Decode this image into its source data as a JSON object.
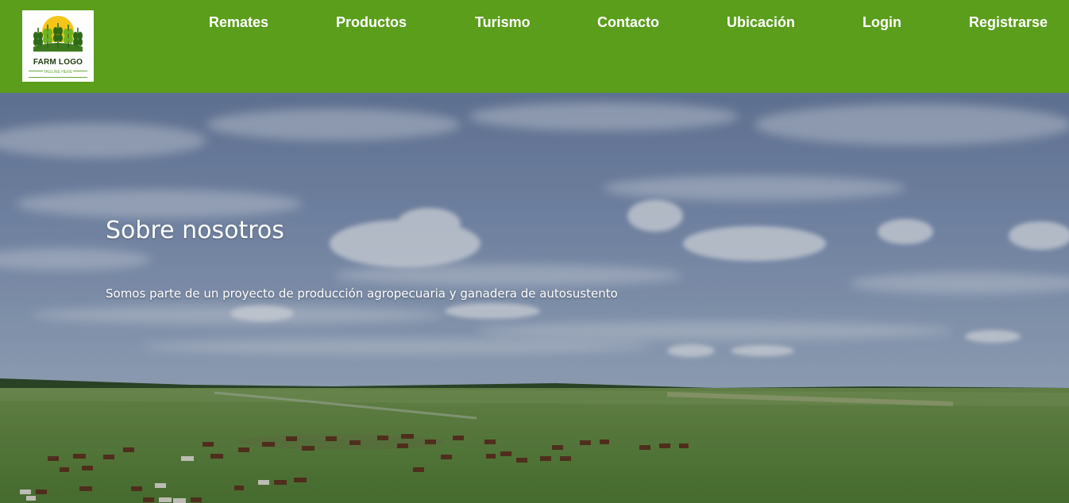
{
  "header": {
    "bg_color": "#5a9e1b",
    "logo": {
      "title": "FARM LOGO",
      "tagline": "TAGLINE HERE",
      "icon": "farm-sun-wheat-icon"
    },
    "nav": [
      {
        "label": "Remates"
      },
      {
        "label": "Productos"
      },
      {
        "label": "Turismo"
      },
      {
        "label": "Contacto"
      },
      {
        "label": "Ubicación"
      },
      {
        "label": "Login"
      },
      {
        "label": "Registrarse"
      }
    ]
  },
  "hero": {
    "title": "Sobre nosotros",
    "text": "Somos parte de un proyecto de producción agropecuaria y ganadera de autosustento",
    "image": "grassland-horses-cloudy-sky"
  }
}
